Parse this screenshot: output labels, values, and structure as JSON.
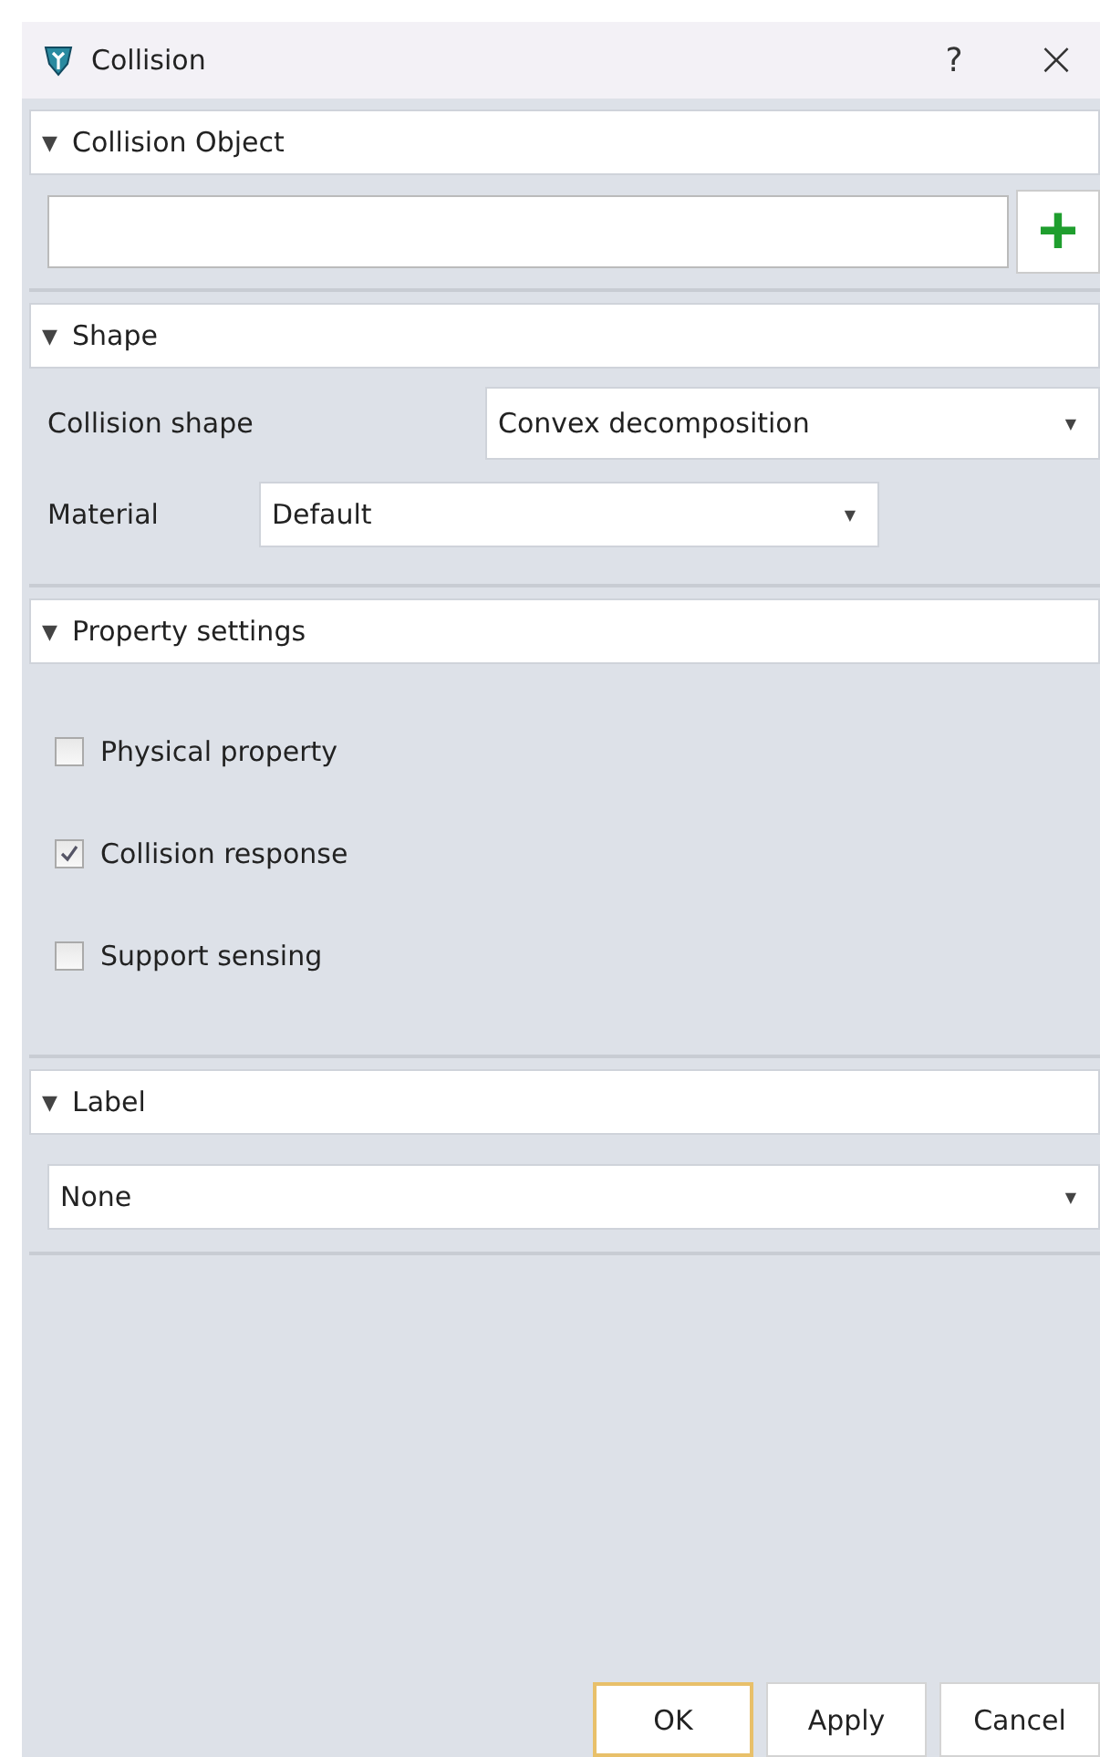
{
  "window": {
    "title": "Collision",
    "help": "?",
    "close": "×"
  },
  "sections": [
    {
      "kind": "object",
      "title": "Collision Object",
      "toggle": "▼",
      "expanded": true,
      "add": "+"
    },
    {
      "kind": "shape",
      "title": "Shape",
      "toggle": "▼",
      "expanded": true,
      "rows": [
        {
          "label": "Collision shape",
          "value": "Convex decomposition",
          "caret": "▼"
        },
        {
          "label": "Material",
          "value": "Default",
          "caret": "▼"
        }
      ]
    },
    {
      "kind": "checks",
      "title": "Property settings",
      "toggle": "▼",
      "expanded": true,
      "items": [
        {
          "label": "Physical property",
          "checked": false
        },
        {
          "label": "Collision response",
          "checked": true
        },
        {
          "label": "Support sensing",
          "checked": false
        }
      ]
    },
    {
      "kind": "select",
      "title": "Label",
      "toggle": "▼",
      "expanded": true,
      "value": "None",
      "caret": "▼"
    }
  ],
  "buttons": [
    {
      "label": "OK",
      "selected": true
    },
    {
      "label": "Apply",
      "selected": false
    },
    {
      "label": "Cancel",
      "selected": false
    }
  ]
}
